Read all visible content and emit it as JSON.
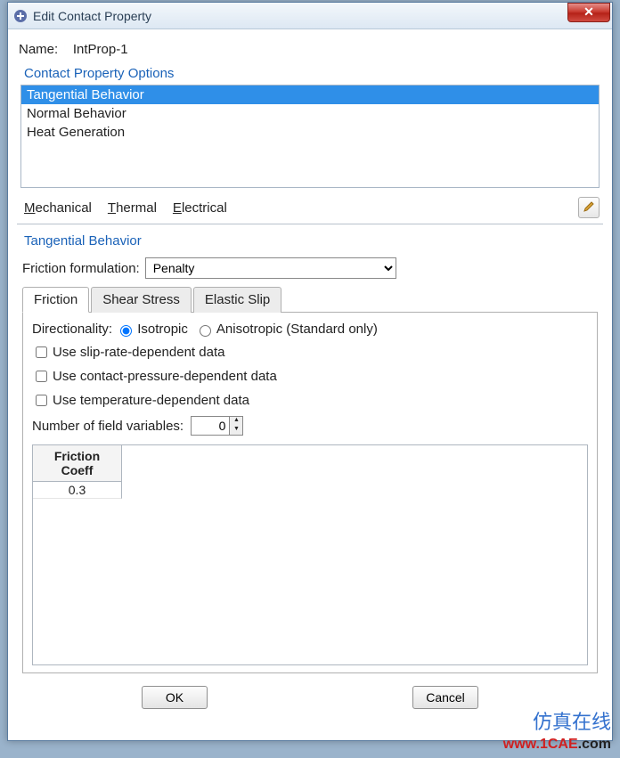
{
  "window": {
    "title": "Edit Contact Property",
    "close_icon": "✕"
  },
  "name_label": "Name:",
  "name_value": "IntProp-1",
  "options_group_label": "Contact Property Options",
  "options": [
    {
      "label": "Tangential Behavior",
      "selected": true
    },
    {
      "label": "Normal Behavior",
      "selected": false
    },
    {
      "label": "Heat Generation",
      "selected": false
    }
  ],
  "menus": {
    "mechanical": "Mechanical",
    "thermal": "Thermal",
    "electrical": "Electrical"
  },
  "section_title": "Tangential Behavior",
  "friction_formulation_label": "Friction formulation:",
  "friction_formulation_value": "Penalty",
  "tabs": [
    {
      "label": "Friction",
      "active": true
    },
    {
      "label": "Shear Stress",
      "active": false
    },
    {
      "label": "Elastic Slip",
      "active": false
    }
  ],
  "directionality": {
    "label": "Directionality:",
    "isotropic": "Isotropic",
    "anisotropic": "Anisotropic (Standard only)",
    "value": "isotropic"
  },
  "checks": {
    "slip_rate": "Use slip-rate-dependent data",
    "contact_pressure": "Use contact-pressure-dependent data",
    "temperature": "Use temperature-dependent data"
  },
  "field_vars": {
    "label": "Number of field variables:",
    "value": "0"
  },
  "table": {
    "header": "Friction\nCoeff",
    "value": "0.3"
  },
  "buttons": {
    "ok": "OK",
    "cancel": "Cancel"
  },
  "watermark": {
    "cn": "仿真在线",
    "url_prefix": "www.",
    "url_mid": "1CAE",
    "url_suffix": ".com"
  }
}
